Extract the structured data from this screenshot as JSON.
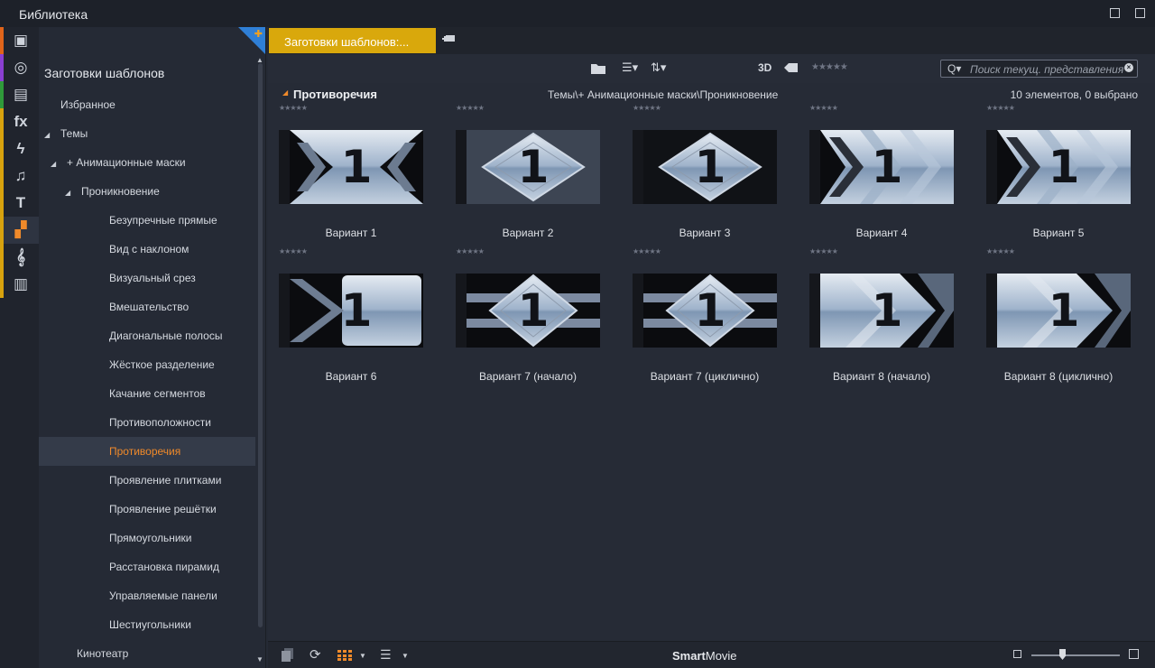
{
  "window": {
    "title": "Библиотека"
  },
  "iconstrip": {
    "items": [
      {
        "icon": "project-bin-icon",
        "color": "#e0641a",
        "glyph": "▣"
      },
      {
        "icon": "media-reel-icon",
        "color": "#8a3fd1",
        "glyph": "◎"
      },
      {
        "icon": "collections-icon",
        "color": "#2f9a3a",
        "glyph": "▤"
      },
      {
        "icon": "effects-fx-icon",
        "color": "#d7a20e",
        "glyph": "fx"
      },
      {
        "icon": "transitions-icon",
        "color": "#d7a20e",
        "glyph": "ϟ"
      },
      {
        "icon": "music-note-icon",
        "color": "#d7a20e",
        "glyph": "♫"
      },
      {
        "icon": "title-text-icon",
        "color": "#d7a20e",
        "glyph": "T"
      },
      {
        "icon": "montage-templates-icon",
        "color": "#d7a20e",
        "glyph": "▞"
      },
      {
        "icon": "audio-clef-icon",
        "color": "#d7a20e",
        "glyph": "𝄞"
      },
      {
        "icon": "piano-keys-icon",
        "color": "#d7a20e",
        "glyph": "▥"
      }
    ]
  },
  "sidebar": {
    "heading": "Заготовки шаблонов",
    "items": [
      {
        "label": "Избранное",
        "indent": 0,
        "tri": ""
      },
      {
        "label": "Темы",
        "indent": 0,
        "tri": "◢"
      },
      {
        "label": "+ Анимационные маски",
        "indent": 1,
        "tri": "◢"
      },
      {
        "label": "Проникновение",
        "indent": 2,
        "tri": "◢"
      },
      {
        "label": "Безупречные прямые",
        "indent": 3,
        "tri": ""
      },
      {
        "label": "Вид с наклоном",
        "indent": 3,
        "tri": ""
      },
      {
        "label": "Визуальный срез",
        "indent": 3,
        "tri": ""
      },
      {
        "label": "Вмешательство",
        "indent": 3,
        "tri": ""
      },
      {
        "label": "Диагональные полосы",
        "indent": 3,
        "tri": ""
      },
      {
        "label": "Жёсткое разделение",
        "indent": 3,
        "tri": ""
      },
      {
        "label": "Качание сегментов",
        "indent": 3,
        "tri": ""
      },
      {
        "label": "Противоположности",
        "indent": 3,
        "tri": ""
      },
      {
        "label": "Противоречия",
        "indent": 3,
        "tri": "",
        "selected": true
      },
      {
        "label": "Проявление плитками",
        "indent": 3,
        "tri": ""
      },
      {
        "label": "Проявление решётки",
        "indent": 3,
        "tri": ""
      },
      {
        "label": "Прямоугольники",
        "indent": 3,
        "tri": ""
      },
      {
        "label": "Расстановка пирамид",
        "indent": 3,
        "tri": ""
      },
      {
        "label": "Управляемые панели",
        "indent": 3,
        "tri": ""
      },
      {
        "label": "Шестиугольники",
        "indent": 3,
        "tri": ""
      },
      {
        "label": "Кинотеатр",
        "indent": 1,
        "tri": ""
      }
    ]
  },
  "tabs": {
    "active": "Заготовки шаблонов:..."
  },
  "toolbar": {
    "three_d": "3D",
    "rating": "★★★★★",
    "search_placeholder": "Поиск текущ. представления",
    "search_q": "Q▾"
  },
  "group": {
    "name": "Противоречия",
    "path": "Темы\\+ Анимационные маски\\Проникновение",
    "count": "10 элементов, 0 выбрано"
  },
  "cards": [
    {
      "label": "Вариант 1",
      "style": "xcross"
    },
    {
      "label": "Вариант 2",
      "style": "diamond"
    },
    {
      "label": "Вариант 3",
      "style": "diamond-dark"
    },
    {
      "label": "Вариант 4",
      "style": "chevrons"
    },
    {
      "label": "Вариант 5",
      "style": "chevrons"
    },
    {
      "label": "Вариант 6",
      "style": "split"
    },
    {
      "label": "Вариант 7 (начало)",
      "style": "diamond-bars"
    },
    {
      "label": "Вариант 7 (циклично)",
      "style": "diamond-bars"
    },
    {
      "label": "Вариант 8 (начало)",
      "style": "xright"
    },
    {
      "label": "Вариант 8 (циклично)",
      "style": "xright"
    }
  ],
  "thumb_digit": "1",
  "card_rating": "★★★★★",
  "bottombar": {
    "brand_bold": "Smart",
    "brand_rest": "Movie"
  }
}
